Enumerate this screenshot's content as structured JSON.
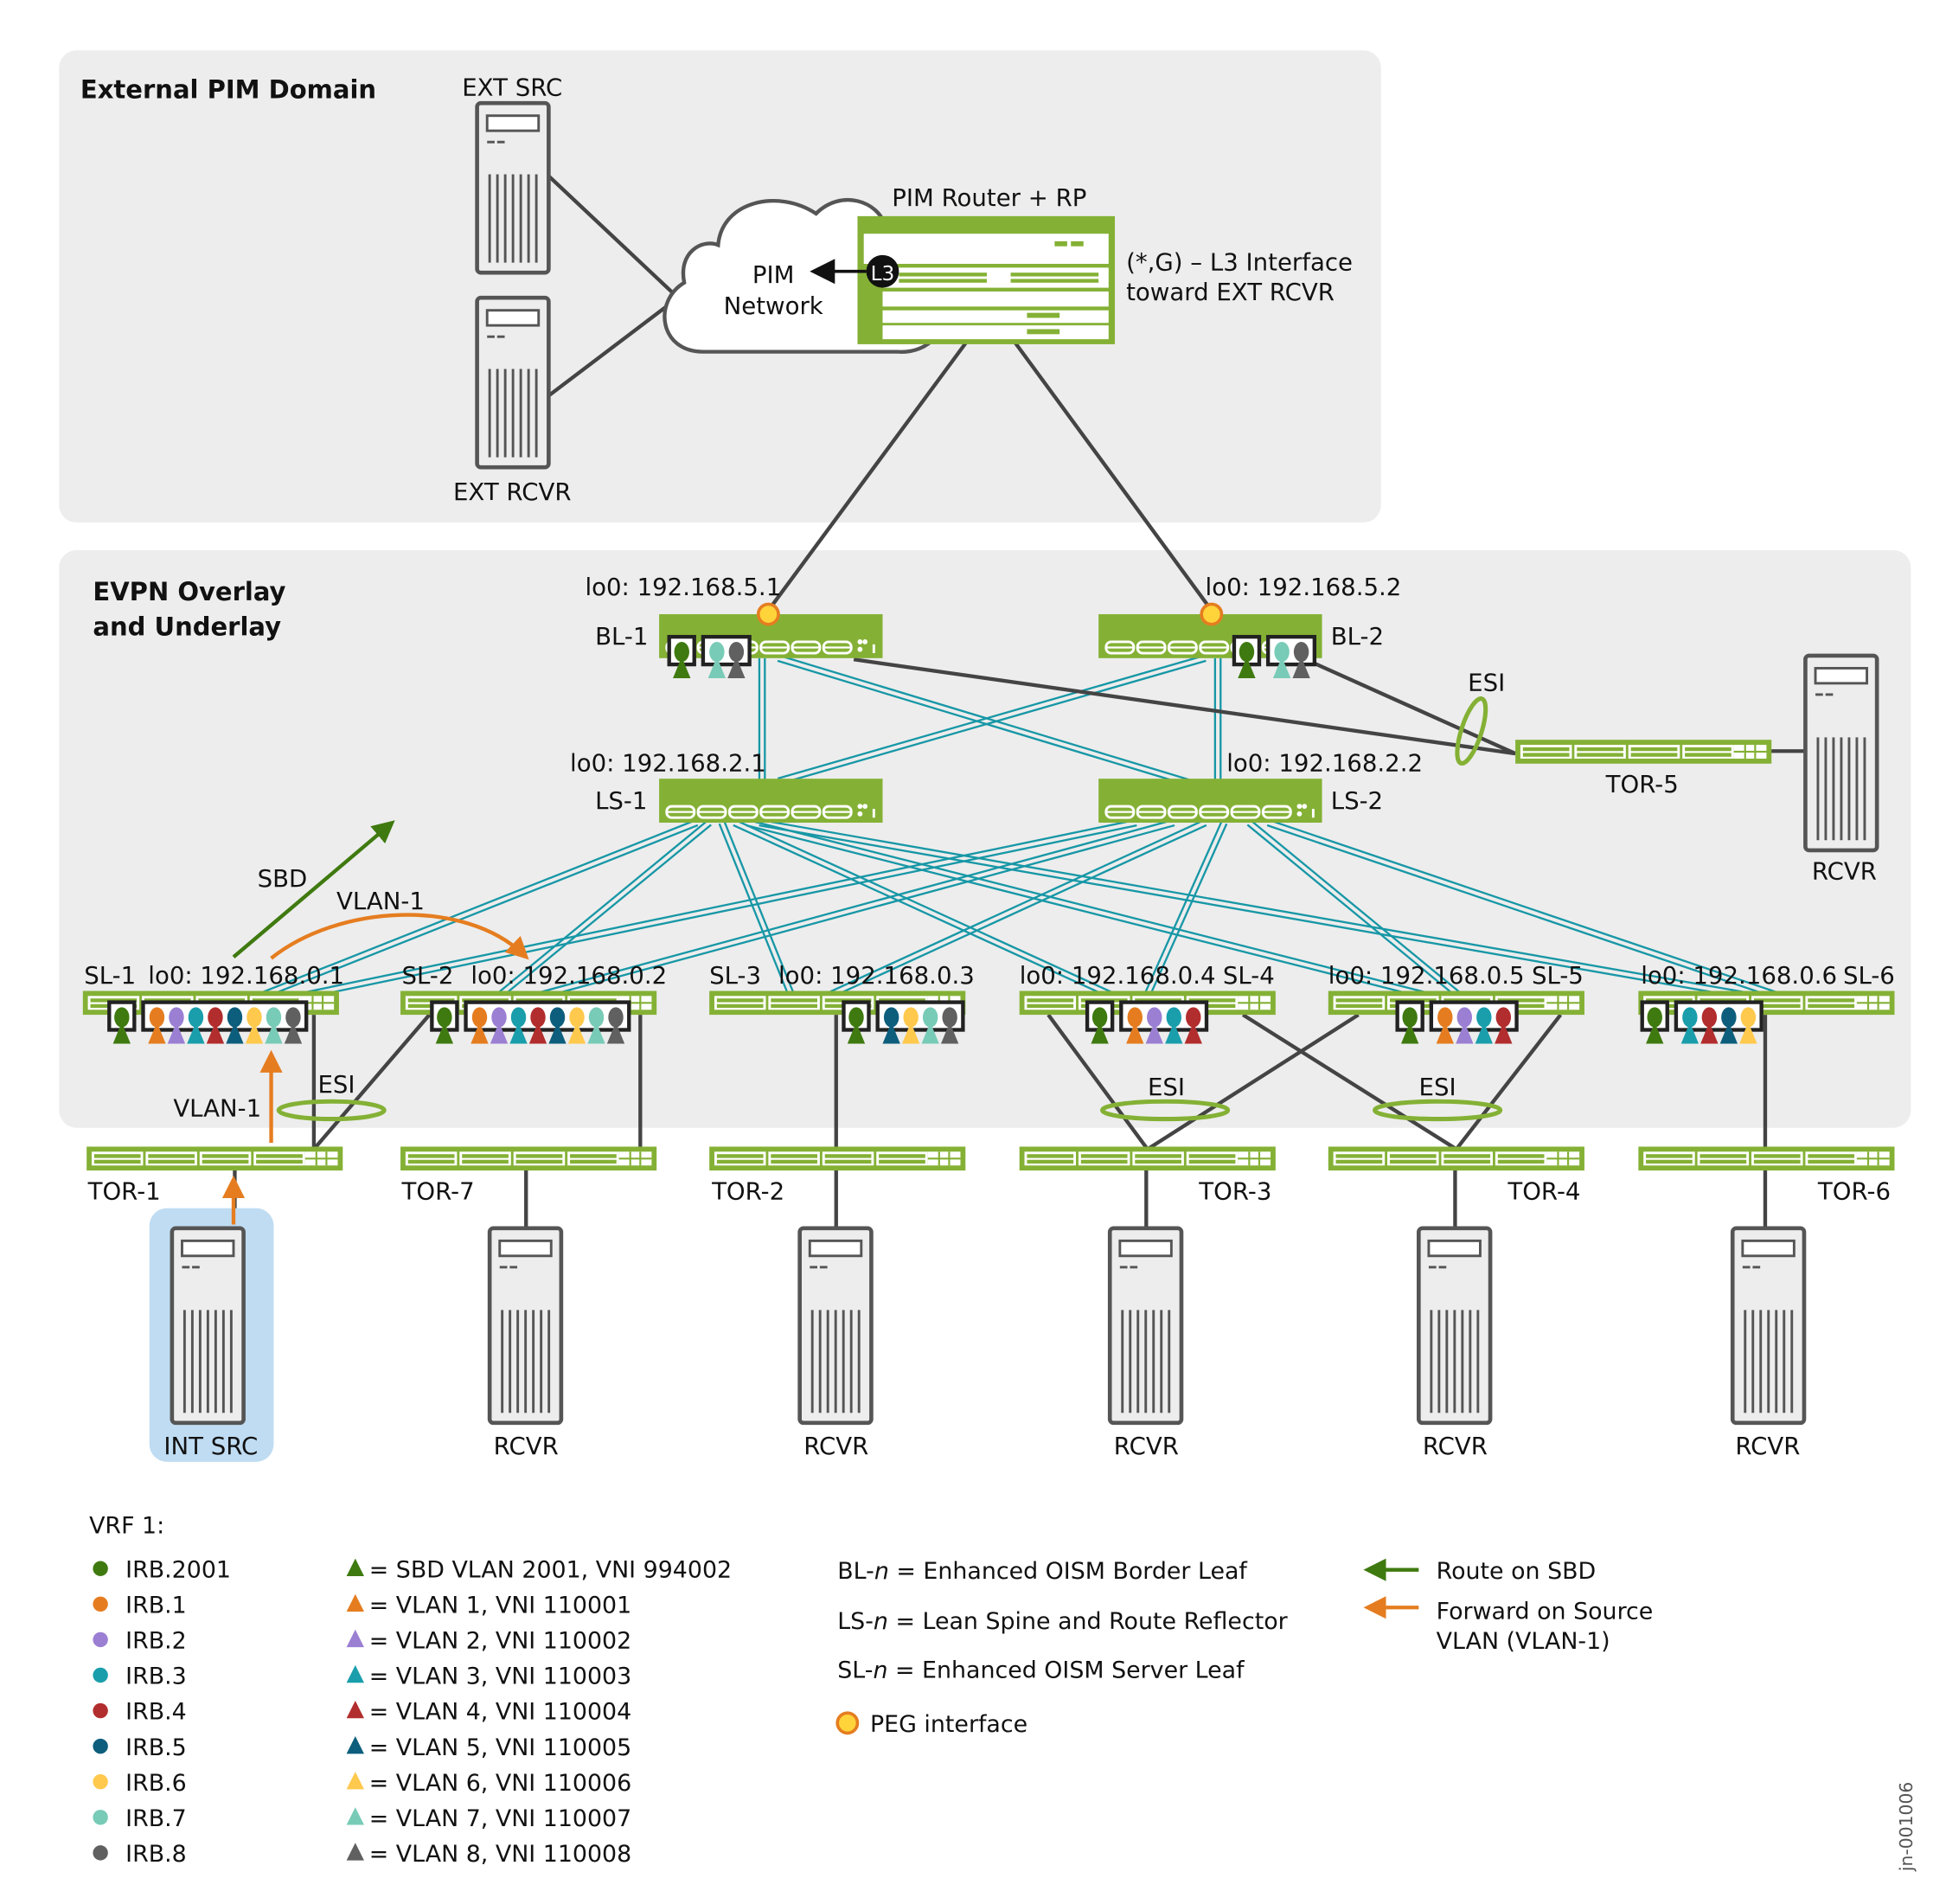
{
  "domains": {
    "external": "External PIM Domain",
    "evpn_line1": "EVPN Overlay",
    "evpn_line2": "and Underlay"
  },
  "external": {
    "ext_src": "EXT SRC",
    "ext_rcvr": "EXT RCVR",
    "cloud_line1": "PIM",
    "cloud_line2": "Network",
    "router_title": "PIM Router + RP",
    "l3_badge": "L3",
    "note_line1": "(*,G) – L3 Interface",
    "note_line2": "toward EXT RCVR"
  },
  "colors": {
    "switch_green": "#84b135",
    "fabric_teal": "#1797a6",
    "sbd_arrow": "#3f7a10",
    "vlan_arrow": "#e57d20",
    "peg_fill": "#ffd43b",
    "peg_ring": "#e57d20",
    "int_src_highlight": "#bfdcf2"
  },
  "irbs": [
    {
      "name": "IRB.2001",
      "color": "#3f7a10"
    },
    {
      "name": "IRB.1",
      "color": "#e57d20"
    },
    {
      "name": "IRB.2",
      "color": "#9b7fd3"
    },
    {
      "name": "IRB.3",
      "color": "#1a9eab"
    },
    {
      "name": "IRB.4",
      "color": "#b22d2d"
    },
    {
      "name": "IRB.5",
      "color": "#0d5e7c"
    },
    {
      "name": "IRB.6",
      "color": "#ffc94d"
    },
    {
      "name": "IRB.7",
      "color": "#78cbb7"
    },
    {
      "name": "IRB.8",
      "color": "#606060"
    }
  ],
  "nodes": {
    "bl1": {
      "name": "BL-1",
      "lo0": "lo0: 192.168.5.1",
      "irbs": [
        0,
        7,
        8
      ]
    },
    "bl2": {
      "name": "BL-2",
      "lo0": "lo0: 192.168.5.2",
      "irbs": [
        0,
        7,
        8
      ]
    },
    "ls1": {
      "name": "LS-1",
      "lo0": "lo0: 192.168.2.1"
    },
    "ls2": {
      "name": "LS-2",
      "lo0": "lo0: 192.168.2.2"
    },
    "sl1": {
      "name": "SL-1",
      "lo0": "lo0: 192.168.0.1",
      "irbs": [
        0,
        1,
        2,
        3,
        4,
        5,
        6,
        7,
        8
      ]
    },
    "sl2": {
      "name": "SL-2",
      "lo0": "lo0: 192.168.0.2",
      "irbs": [
        0,
        1,
        2,
        3,
        4,
        5,
        6,
        7,
        8
      ]
    },
    "sl3": {
      "name": "SL-3",
      "lo0": "lo0: 192.168.0.3",
      "irbs": [
        0,
        5,
        6,
        7,
        8
      ]
    },
    "sl4": {
      "name": "SL-4",
      "lo0": "lo0: 192.168.0.4",
      "irbs": [
        0,
        1,
        2,
        3,
        4
      ]
    },
    "sl5": {
      "name": "SL-5",
      "lo0": "lo0: 192.168.0.5",
      "irbs": [
        0,
        1,
        2,
        3,
        4
      ]
    },
    "sl6": {
      "name": "SL-6",
      "lo0": "lo0: 192.168.0.6",
      "irbs": [
        0,
        3,
        4,
        5,
        6
      ]
    },
    "tor1": {
      "name": "TOR-1"
    },
    "tor2": {
      "name": "TOR-2"
    },
    "tor3": {
      "name": "TOR-3"
    },
    "tor4": {
      "name": "TOR-4"
    },
    "tor5": {
      "name": "TOR-5"
    },
    "tor6": {
      "name": "TOR-6"
    },
    "tor7": {
      "name": "TOR-7"
    }
  },
  "hosts": {
    "int_src": "INT SRC",
    "rcvr": "RCVR"
  },
  "annotations": {
    "esi": "ESI",
    "sbd": "SBD",
    "vlan1": "VLAN-1"
  },
  "legend": {
    "vrf_title": "VRF 1:",
    "irb_labels": [
      "IRB.2001",
      "IRB.1",
      "IRB.2",
      "IRB.3",
      "IRB.4",
      "IRB.5",
      "IRB.6",
      "IRB.7",
      "IRB.8"
    ],
    "vlan_labels": [
      "= SBD VLAN 2001, VNI 994002",
      "= VLAN 1, VNI 110001",
      "= VLAN 2, VNI 110002",
      "= VLAN 3, VNI 110003",
      "= VLAN 4, VNI 110004",
      "= VLAN 5, VNI 110005",
      "= VLAN 6, VNI 110006",
      "= VLAN 7, VNI 110007",
      "= VLAN 8, VNI 110008"
    ],
    "roles": [
      {
        "abbr": "BL-",
        "n": "n",
        "desc": " = Enhanced OISM Border Leaf"
      },
      {
        "abbr": "LS-",
        "n": "n",
        "desc": " = Lean Spine and Route Reflector"
      },
      {
        "abbr": "SL-",
        "n": "n",
        "desc": " = Enhanced OISM Server Leaf"
      }
    ],
    "peg": "PEG interface",
    "route_sbd": "Route on SBD",
    "fwd_line1": "Forward on Source",
    "fwd_line2": "VLAN (VLAN-1)"
  },
  "figure_id": "jn-001006"
}
